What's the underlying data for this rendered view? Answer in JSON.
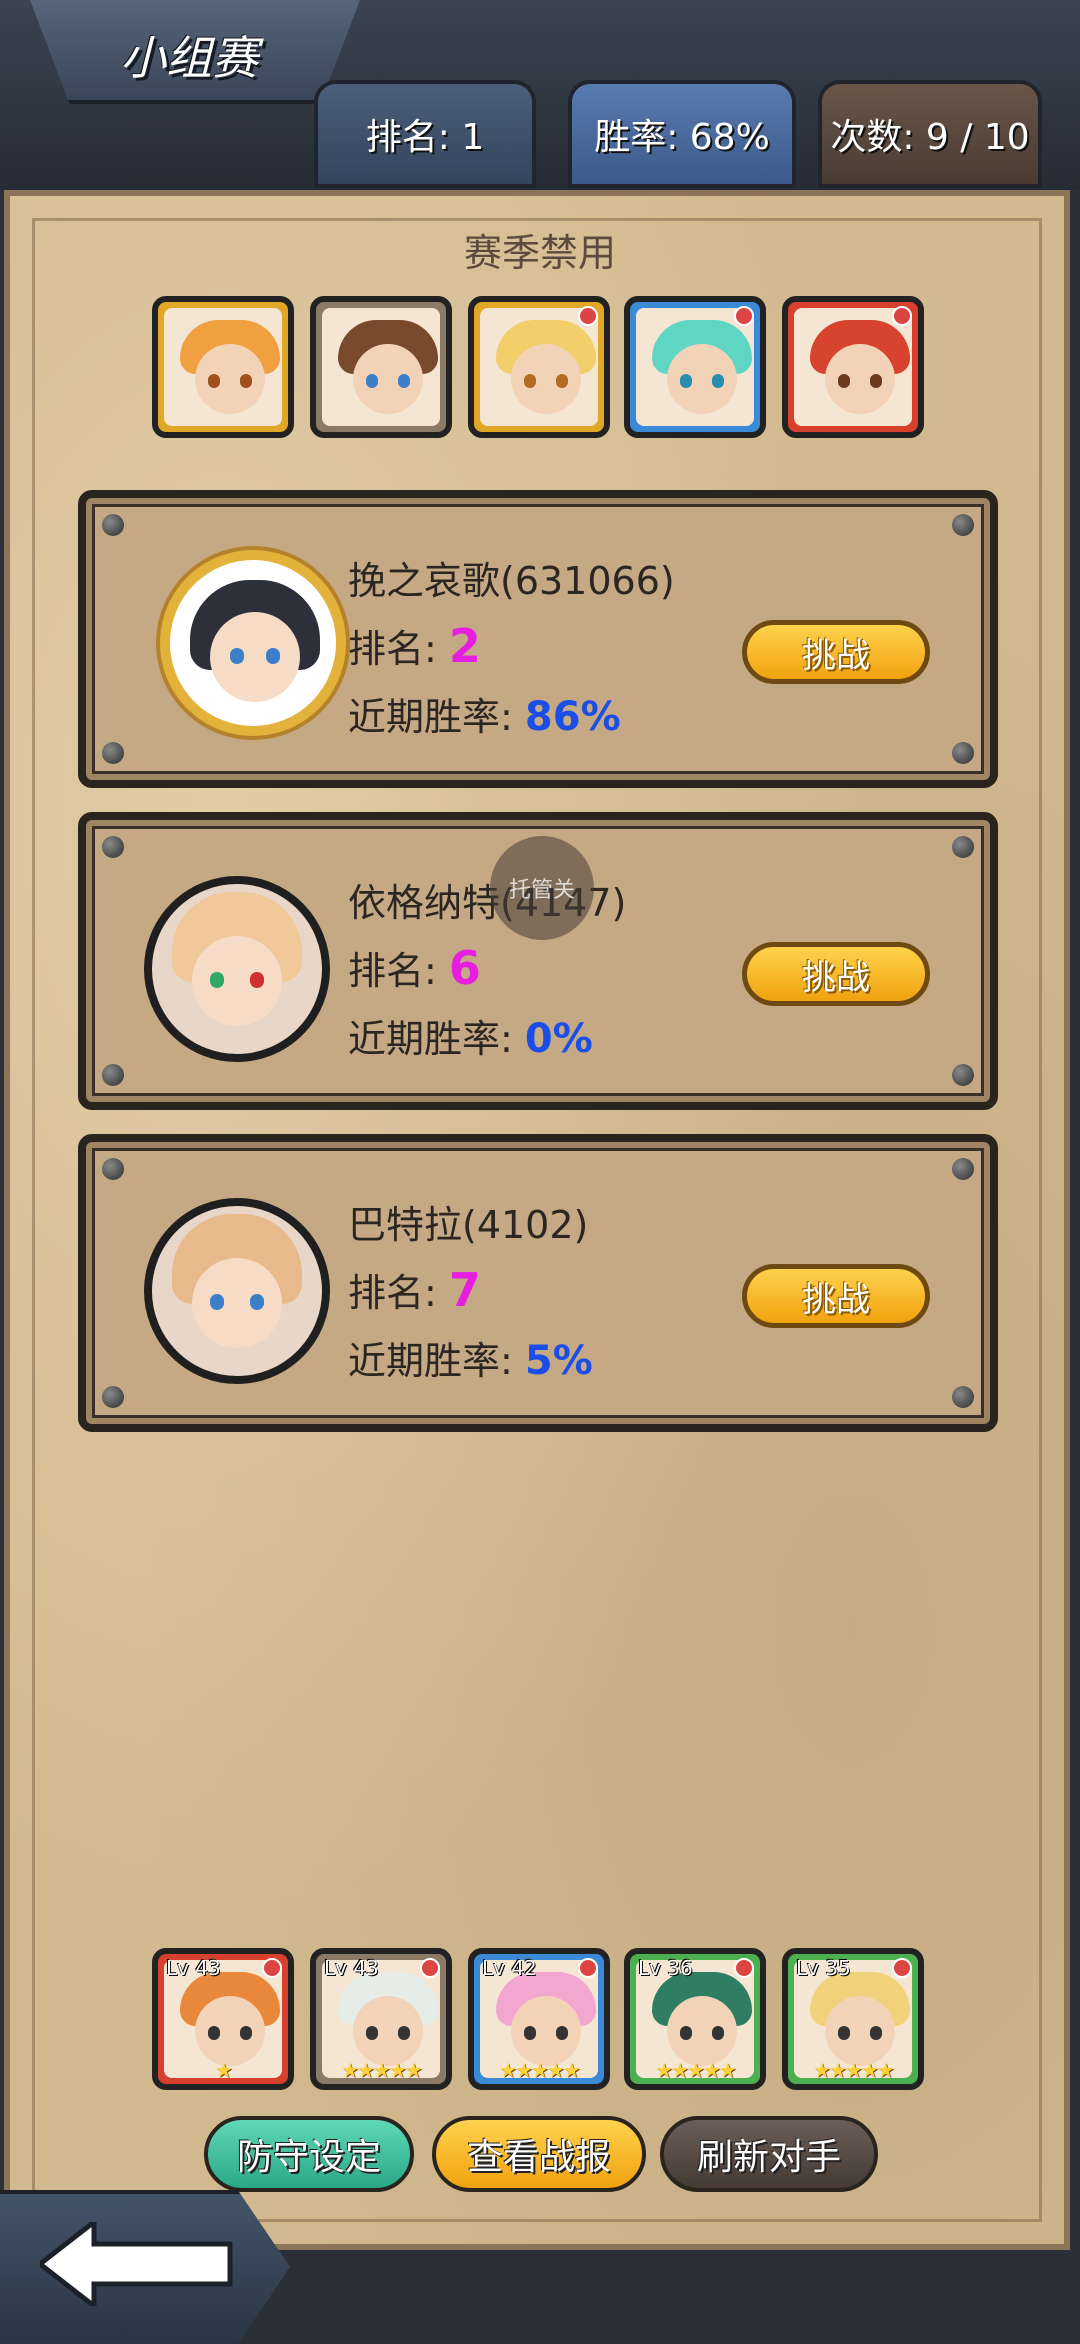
{
  "header": {
    "title": "小组赛"
  },
  "stats": {
    "rank": "排名: 1",
    "win_rate": "胜率: 68%",
    "attempts": "次数: 9 / 10"
  },
  "season_ban": {
    "title": "赛季禁用",
    "heroes": [
      {
        "frame": "#e0a826",
        "hair": "#f0a040",
        "eyes": "#a0501e"
      },
      {
        "frame": "#8b7a66",
        "hair": "#7a4a2e",
        "eyes": "#3b7ec9"
      },
      {
        "frame": "#e0a826",
        "hair": "#f3cf6b",
        "eyes": "#b06c22"
      },
      {
        "frame": "#3a8ad8",
        "hair": "#5fd6c3",
        "eyes": "#2a8db0"
      },
      {
        "frame": "#d8402e",
        "hair": "#d8432f",
        "eyes": "#6b3a1e"
      }
    ]
  },
  "opponents": [
    {
      "name": "挽之哀歌(631066)",
      "rank_label": "排名:",
      "rank": "2",
      "rate_label": "近期胜率:",
      "rate": "86%",
      "button": "挑战"
    },
    {
      "name": "依格纳特(4147)",
      "rank_label": "排名:",
      "rank": "6",
      "rate_label": "近期胜率:",
      "rate": "0%",
      "button": "挑战"
    },
    {
      "name": "巴特拉(4102)",
      "rank_label": "排名:",
      "rank": "7",
      "rate_label": "近期胜率:",
      "rate": "5%",
      "button": "挑战"
    }
  ],
  "overlay_text": "托管关",
  "team": [
    {
      "level": "Lv 43",
      "stars": "★",
      "frame": "#d8402e",
      "hair": "#e9873b"
    },
    {
      "level": "Lv 43",
      "stars": "★★★★★",
      "frame": "#8b7a66",
      "hair": "#e6ece7"
    },
    {
      "level": "Lv 42",
      "stars": "★★★★★",
      "frame": "#3a8ad8",
      "hair": "#f2a6d0"
    },
    {
      "level": "Lv 36",
      "stars": "★★★★★",
      "frame": "#4caf50",
      "hair": "#2f7d62"
    },
    {
      "level": "Lv 35",
      "stars": "★★★★★",
      "frame": "#4caf50",
      "hair": "#f1d27a"
    }
  ],
  "buttons": {
    "defense": "防守设定",
    "battle_report": "查看战报",
    "refresh": "刷新对手"
  },
  "colors": {
    "rank_value": "#e51ee0",
    "rate_value": "#1a4ee6",
    "parchment": "#d2b98f"
  }
}
